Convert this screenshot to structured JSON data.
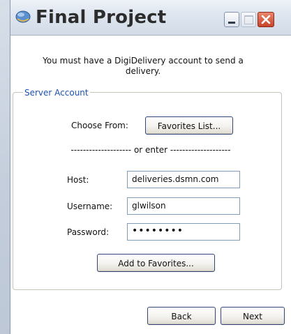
{
  "window": {
    "title": "Final Project"
  },
  "message": {
    "line1": "You must have a DigiDelivery account to send a",
    "line2": "delivery."
  },
  "server_account": {
    "group_label": "Server Account",
    "choose_from_label": "Choose From:",
    "favorites_button": "Favorites List...",
    "divider": "-------------------- or enter --------------------",
    "host_label": "Host:",
    "host_value": "deliveries.dsmn.com",
    "username_label": "Username:",
    "username_value": "glwilson",
    "password_label": "Password:",
    "password_value": "••••••••",
    "add_favorites_button": "Add to Favorites..."
  },
  "footer": {
    "back_button": "Back",
    "next_button": "Next"
  },
  "icons": {
    "app": "app-icon",
    "minimize": "minimize-icon",
    "maximize": "maximize-icon",
    "close": "close-icon"
  },
  "colors": {
    "group_label": "#1d4fb3",
    "close_button": "#c8432a",
    "window_background": "#ffffff"
  }
}
